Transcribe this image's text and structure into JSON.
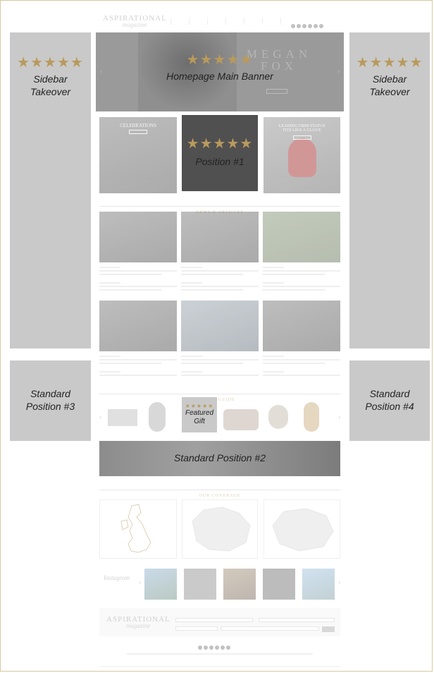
{
  "header": {
    "logo_main": "ASPIRATIONAL",
    "logo_sub": "magazine",
    "nav": [
      "",
      "",
      "",
      "",
      "",
      "",
      ""
    ]
  },
  "ads": {
    "sidebar_left_label": "Sidebar\nTakeover",
    "sidebar_right_label": "Sidebar\nTakeover",
    "main_banner_label": "Homepage Main Banner",
    "position1_label": "Position #1",
    "position2_label": "Standard Position #2",
    "position3_label": "Standard\nPosition #3",
    "position4_label": "Standard\nPosition #4",
    "featured_gift_label": "Featured\nGift",
    "stars": "★★★★★"
  },
  "banner": {
    "name_line1": "MEGAN",
    "name_line2": "FOX"
  },
  "promos": [
    {
      "title": "CELEBRATIONS"
    },
    {
      "title": ""
    },
    {
      "title": "LEADING FIRM STATUS\nFITS LIKE A GLOVE"
    }
  ],
  "sections": {
    "news": "NEWS & ARTICLES",
    "gift": "GIFT GUIDE",
    "coverage": "OUR COVERAGE"
  },
  "news_cards": [
    {
      "caption": ""
    },
    {
      "caption": ""
    },
    {
      "caption": ""
    },
    {
      "caption": ""
    },
    {
      "caption": ""
    },
    {
      "caption": ""
    }
  ],
  "instagram": {
    "label": "Instagram"
  },
  "footer": {
    "logo_main": "ASPIRATIONAL",
    "logo_sub": "magazine"
  },
  "colors": {
    "ad_gray": "#c9c9c9",
    "star_gold": "#b89a5c",
    "border_gold": "#d8c8a0"
  }
}
